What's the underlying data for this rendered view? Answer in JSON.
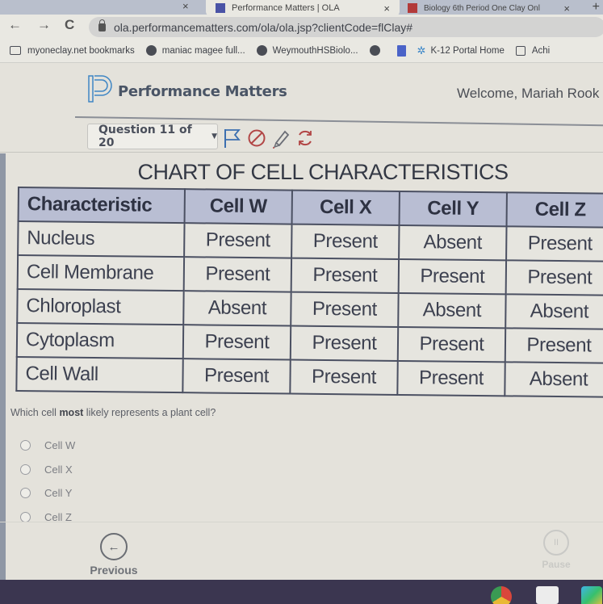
{
  "browser": {
    "tabs": [
      {
        "title": "Performance Matters | OLA",
        "active": true
      },
      {
        "title": "Biology 6th Period One Clay Onl",
        "active": false
      }
    ],
    "close_glyph": "×",
    "new_tab_glyph": "+",
    "nav": {
      "back": "←",
      "forward": "→",
      "reload": "C"
    },
    "url": "ola.performancematters.com/ola/ola.jsp?clientCode=flClay#",
    "bookmarks": [
      {
        "label": "myoneclay.net bookmarks",
        "icon": "folder-icon"
      },
      {
        "label": "maniac magee full...",
        "icon": "globe-icon"
      },
      {
        "label": "WeymouthHSBiolo...",
        "icon": "globe-icon"
      },
      {
        "label": "",
        "icon": "globe-icon"
      },
      {
        "label": "",
        "icon": "doc-icon"
      },
      {
        "label": "K-12 Portal Home",
        "icon": "k12-icon"
      },
      {
        "label": "Achi",
        "icon": "achieve-icon"
      }
    ]
  },
  "app": {
    "brand": "Performance Matters",
    "welcome": "Welcome, Mariah Rook",
    "question_selector": "Question 11 of 20",
    "tools": [
      "flag-icon",
      "eliminate-icon",
      "highlighter-icon",
      "reset-icon"
    ]
  },
  "chart": {
    "title": "CHART OF CELL CHARACTERISTICS",
    "headers": [
      "Characteristic",
      "Cell W",
      "Cell X",
      "Cell Y",
      "Cell Z"
    ],
    "rows": [
      [
        "Nucleus",
        "Present",
        "Present",
        "Absent",
        "Present"
      ],
      [
        "Cell Membrane",
        "Present",
        "Present",
        "Present",
        "Present"
      ],
      [
        "Chloroplast",
        "Absent",
        "Present",
        "Absent",
        "Absent"
      ],
      [
        "Cytoplasm",
        "Present",
        "Present",
        "Present",
        "Present"
      ],
      [
        "Cell Wall",
        "Present",
        "Present",
        "Present",
        "Absent"
      ]
    ]
  },
  "question": {
    "prefix": "Which cell ",
    "emphasis": "most",
    "suffix": " likely represents a plant cell?",
    "options": [
      "Cell W",
      "Cell X",
      "Cell Y",
      "Cell Z"
    ]
  },
  "footer": {
    "previous_label": "Previous",
    "previous_glyph": "←",
    "pause_label": "Pause",
    "pause_glyph": "II"
  }
}
